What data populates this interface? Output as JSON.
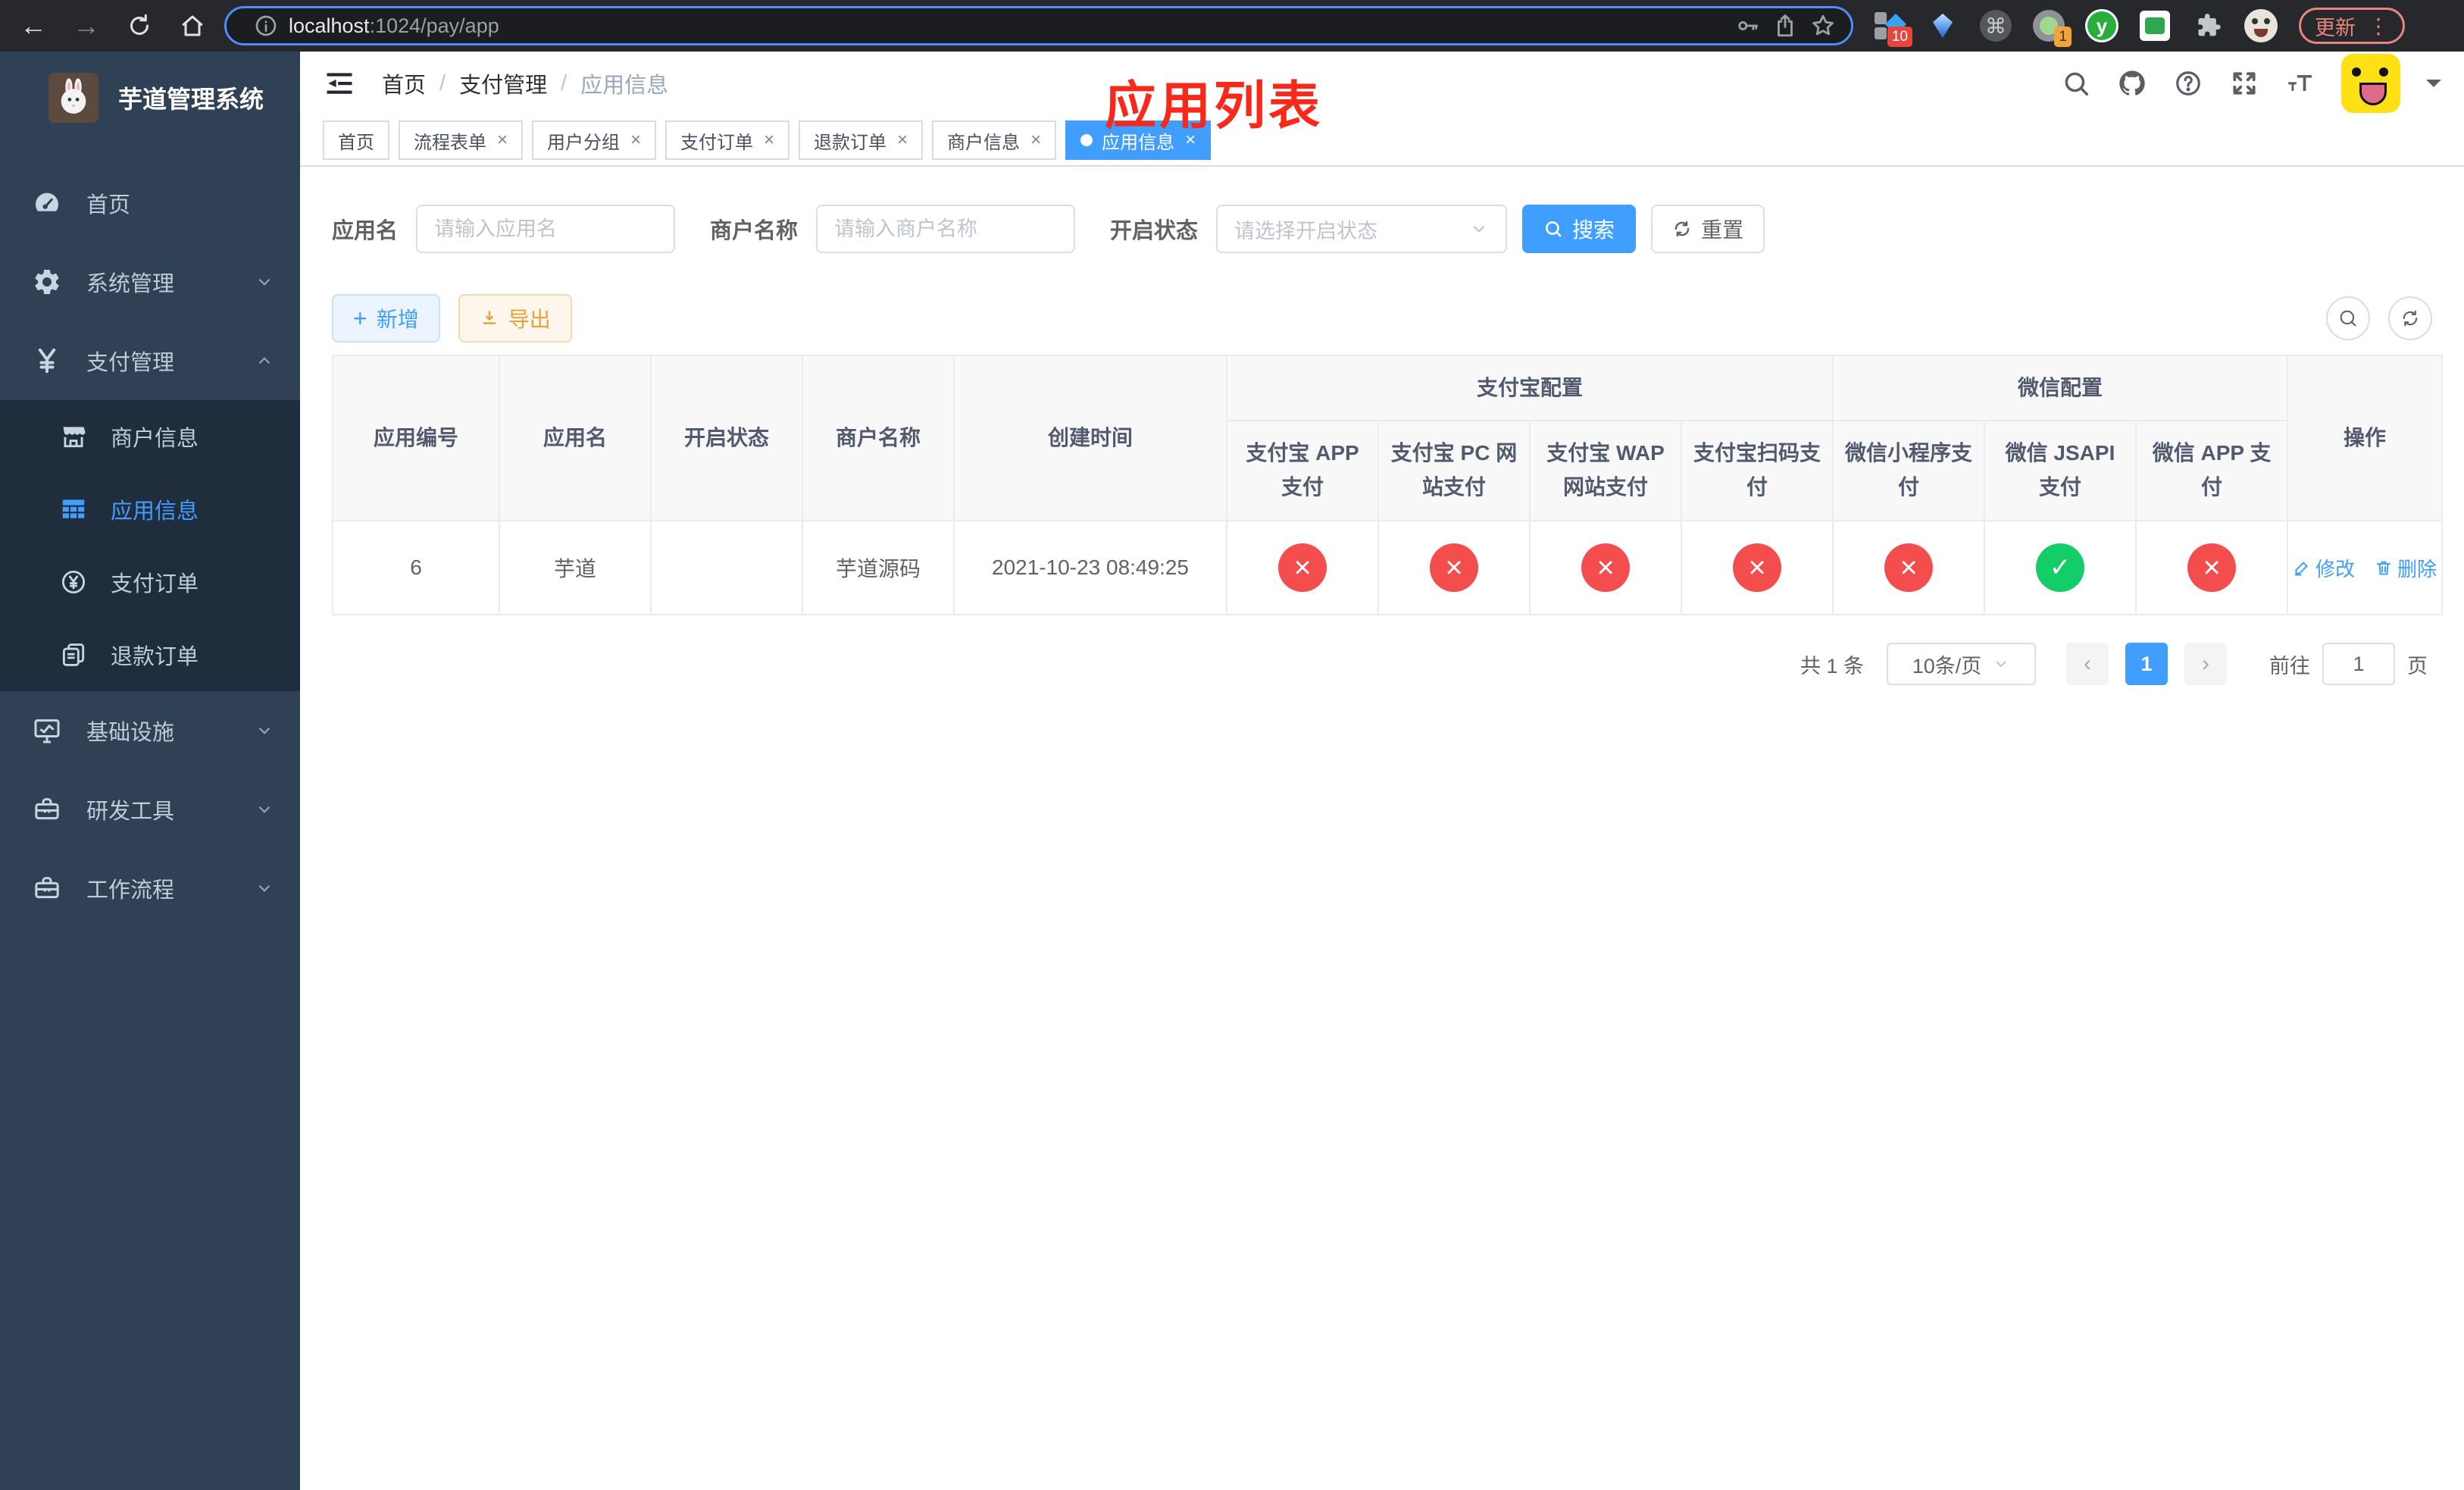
{
  "browser": {
    "url_host": "localhost",
    "url_path": ":1024/pay/app",
    "update_label": "更新",
    "badges": {
      "pin": "10",
      "record": "1"
    }
  },
  "sidebar": {
    "logo_title": "芋道管理系统",
    "menu": [
      {
        "label": "首页"
      },
      {
        "label": "系统管理"
      },
      {
        "label": "支付管理"
      },
      {
        "label": "基础设施"
      },
      {
        "label": "研发工具"
      },
      {
        "label": "工作流程"
      }
    ],
    "submenu": [
      {
        "label": "商户信息"
      },
      {
        "label": "应用信息"
      },
      {
        "label": "支付订单"
      },
      {
        "label": "退款订单"
      }
    ]
  },
  "navbar": {
    "breadcrumb": [
      "首页",
      "支付管理",
      "应用信息"
    ],
    "separator": "/",
    "annotation": "应用列表"
  },
  "tags": [
    {
      "label": "首页"
    },
    {
      "label": "流程表单"
    },
    {
      "label": "用户分组"
    },
    {
      "label": "支付订单"
    },
    {
      "label": "退款订单"
    },
    {
      "label": "商户信息"
    },
    {
      "label": "应用信息"
    }
  ],
  "filters": {
    "app_name_label": "应用名",
    "app_name_placeholder": "请输入应用名",
    "merchant_label": "商户名称",
    "merchant_placeholder": "请输入商户名称",
    "status_label": "开启状态",
    "status_placeholder": "请选择开启状态",
    "search_label": "搜索",
    "reset_label": "重置"
  },
  "toolbar": {
    "add_label": "新增",
    "export_label": "导出"
  },
  "table": {
    "headers": {
      "app_id": "应用编号",
      "app_name": "应用名",
      "status": "开启状态",
      "merchant": "商户名称",
      "created": "创建时间",
      "alipay_group": "支付宝配置",
      "wechat_group": "微信配置",
      "actions": "操作",
      "sub": [
        "支付宝 APP 支付",
        "支付宝 PC 网站支付",
        "支付宝 WAP 网站支付",
        "支付宝扫码支付",
        "微信小程序支付",
        "微信 JSAPI 支付",
        "微信 APP 支付"
      ]
    },
    "rows": [
      {
        "app_id": "6",
        "app_name": "芋道",
        "status_on": true,
        "merchant": "芋道源码",
        "created": "2021-10-23 08:49:25",
        "configs": [
          "no",
          "no",
          "no",
          "no",
          "no",
          "yes",
          "no"
        ],
        "edit_label": "修改",
        "delete_label": "删除"
      }
    ]
  },
  "pagination": {
    "total": "共 1 条",
    "page_size": "10条/页",
    "page": "1",
    "goto_label": "前往",
    "goto_value": "1",
    "unit_label": "页"
  },
  "colors": {
    "accent": "#409eff",
    "success": "#13ce66",
    "danger": "#f34d4d",
    "sidebar_bg": "#304156",
    "submenu_bg": "#1f2d3d",
    "annotation": "#f8281a",
    "warning": "#e6a23c"
  }
}
